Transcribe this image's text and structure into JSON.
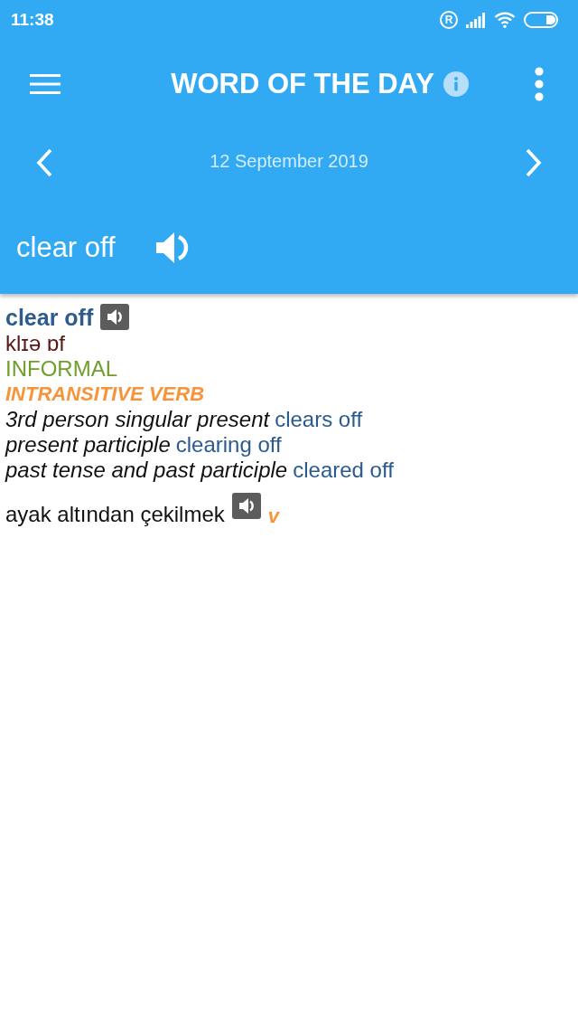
{
  "status_bar": {
    "time": "11:38",
    "roaming": "R"
  },
  "toolbar": {
    "title": "WORD OF THE DAY"
  },
  "date_nav": {
    "date": "12 September 2019"
  },
  "word_banner": {
    "word": "clear off"
  },
  "entry": {
    "headword": "clear off",
    "pronunciation": "klɪə ɒf",
    "register": "INFORMAL",
    "part_of_speech": "INTRANSITIVE VERB",
    "forms": [
      {
        "label": "3rd person singular present",
        "value": "clears off"
      },
      {
        "label": "present participle",
        "value": "clearing off"
      },
      {
        "label": "past tense and past participle",
        "value": "cleared off"
      }
    ],
    "translations": [
      {
        "text": "ayak altından çekilmek",
        "pos": "v"
      }
    ]
  }
}
